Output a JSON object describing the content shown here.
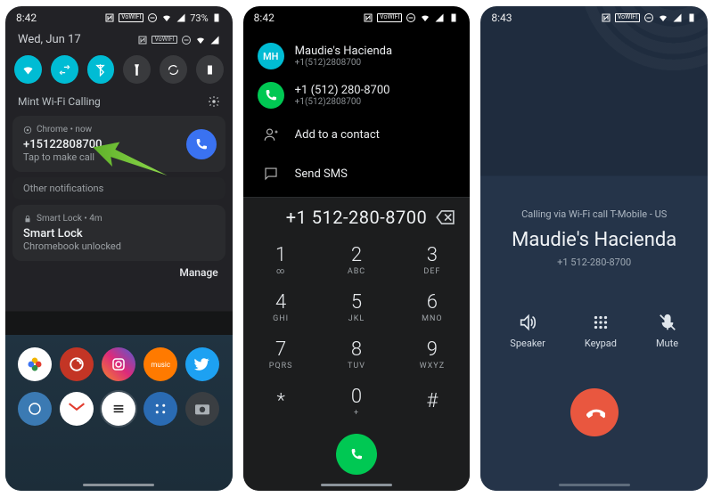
{
  "screen1": {
    "status": {
      "time": "8:42",
      "battery": "73%",
      "vowifi": "VoWIFI"
    },
    "date": "Wed, Jun 17",
    "qs": [
      "wifi",
      "data",
      "bluetooth",
      "flashlight",
      "rotate",
      "battery-saver"
    ],
    "wifi_calling_label": "Mint Wi-Fi Calling",
    "notif_chrome": {
      "src": "Chrome  •  now",
      "title": "+15122808700",
      "sub": "Tap to make call"
    },
    "other_label": "Other notifications",
    "notif_smartlock": {
      "src": "Smart Lock  •  4m",
      "title": "Smart Lock",
      "sub": "Chromebook unlocked"
    },
    "manage": "Manage"
  },
  "screen2": {
    "status": {
      "time": "8:42",
      "vowifi": "VoWIFI"
    },
    "items": [
      {
        "avatar": "MH",
        "title": "Maudie's Hacienda",
        "sub": "+1(512)2808700"
      },
      {
        "title": "+1 (512) 280-8700",
        "sub": "+1(512)2808700"
      },
      {
        "title": "Add to a contact"
      },
      {
        "title": "Send SMS"
      }
    ],
    "dialed": "+1 512-280-8700",
    "keys": [
      {
        "d": "1",
        "l": "∞"
      },
      {
        "d": "2",
        "l": "ABC"
      },
      {
        "d": "3",
        "l": "DEF"
      },
      {
        "d": "4",
        "l": "GHI"
      },
      {
        "d": "5",
        "l": "JKL"
      },
      {
        "d": "6",
        "l": "MNO"
      },
      {
        "d": "7",
        "l": "PQRS"
      },
      {
        "d": "8",
        "l": "TUV"
      },
      {
        "d": "9",
        "l": "WXYZ"
      },
      {
        "d": "*",
        "l": ""
      },
      {
        "d": "0",
        "l": "+"
      },
      {
        "d": "#",
        "l": ""
      }
    ]
  },
  "screen3": {
    "status": {
      "time": "8:43",
      "vowifi": "VoWIFI"
    },
    "calling": "Calling via Wi-Fi call T-Mobile - US",
    "callee": "Maudie's Hacienda",
    "number": "+1 512-280-8700",
    "controls": {
      "speaker": "Speaker",
      "keypad": "Keypad",
      "mute": "Mute"
    }
  }
}
